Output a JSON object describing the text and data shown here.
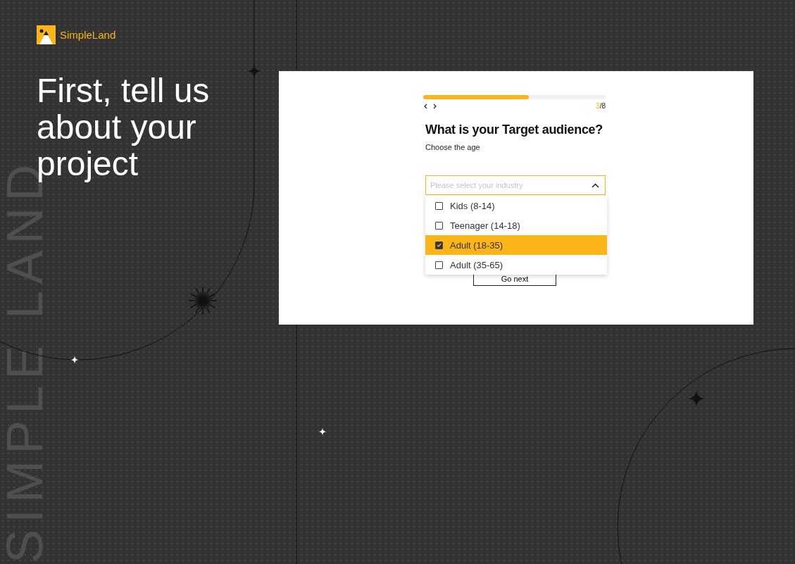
{
  "brand": {
    "name": "SimpleLand"
  },
  "headline": "First, tell us about your project",
  "watermark": "SIMPLE LAND",
  "progress": {
    "level": 0.58,
    "current": "3",
    "total": "/8"
  },
  "question": {
    "title": "What is your Target audience?",
    "subtitle": "Choose the age"
  },
  "select": {
    "placeholder": "Please select your industry",
    "expanded": true,
    "options": [
      {
        "label": "Kids (8-14)",
        "checked": false,
        "selected": false
      },
      {
        "label": "Teenager (14-18)",
        "checked": false,
        "selected": false
      },
      {
        "label": "Adult (18-35)",
        "checked": true,
        "selected": true
      },
      {
        "label": "Adult (35-65)",
        "checked": false,
        "selected": false
      }
    ]
  },
  "next_button": "Go next"
}
